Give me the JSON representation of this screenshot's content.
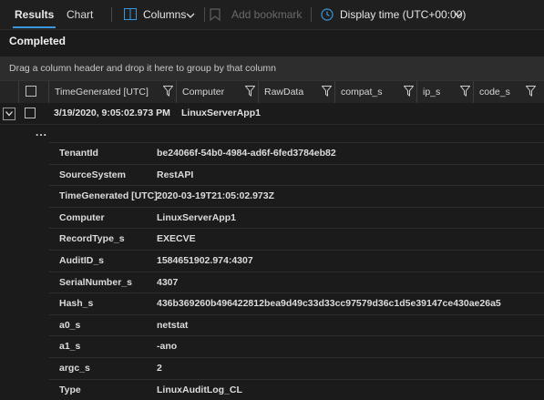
{
  "toolbar": {
    "tabs": [
      {
        "label": "Results"
      },
      {
        "label": "Chart"
      }
    ],
    "columns_label": "Columns",
    "bookmark_label": "Add bookmark",
    "display_time_label": "Display time (UTC+00:00)"
  },
  "status": "Completed",
  "group_hint": "Drag a column header and drop it here to group by that column",
  "columns": [
    {
      "label": "TimeGenerated [UTC]"
    },
    {
      "label": "Computer"
    },
    {
      "label": "RawData"
    },
    {
      "label": "compat_s"
    },
    {
      "label": "ip_s"
    },
    {
      "label": "code_s"
    }
  ],
  "row": {
    "time": "3/19/2020, 9:05:02.973 PM",
    "computer": "LinuxServerApp1",
    "ellipsis": "..."
  },
  "details": [
    {
      "key": "TenantId",
      "value": "be24066f-54b0-4984-ad6f-6fed3784eb82"
    },
    {
      "key": "SourceSystem",
      "value": "RestAPI"
    },
    {
      "key": "TimeGenerated [UTC]",
      "value": "2020-03-19T21:05:02.973Z"
    },
    {
      "key": "Computer",
      "value": "LinuxServerApp1"
    },
    {
      "key": "RecordType_s",
      "value": "EXECVE"
    },
    {
      "key": "AuditID_s",
      "value": "1584651902.974:4307"
    },
    {
      "key": "SerialNumber_s",
      "value": "4307"
    },
    {
      "key": "Hash_s",
      "value": "436b369260b496422812bea9d49c33d33cc97579d36c1d5e39147ce430ae26a5"
    },
    {
      "key": "a0_s",
      "value": "netstat"
    },
    {
      "key": "a1_s",
      "value": "-ano"
    },
    {
      "key": "argc_s",
      "value": "2"
    },
    {
      "key": "Type",
      "value": "LinuxAuditLog_CL"
    }
  ]
}
